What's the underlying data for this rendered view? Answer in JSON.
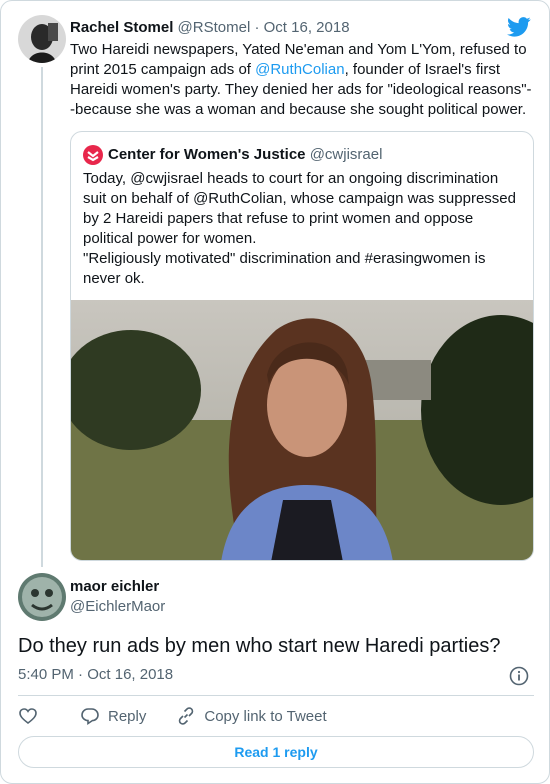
{
  "tweet": {
    "author_name": "Rachel Stomel",
    "author_handle": "@RStomel",
    "date": "Oct 16, 2018",
    "text_before_link": "Two Hareidi newspapers, Yated Ne'eman and Yom L'Yom, refused to print 2015 campaign ads of ",
    "link_text": "@RuthColian",
    "text_after_link": ", founder of Israel's first Hareidi women's party. They denied her ads for \"ideological reasons\"--because she was a woman and because she sought political power."
  },
  "quote": {
    "author_name": "Center for Women's Justice",
    "author_handle": "@cwjisrael",
    "text_lines": [
      "Today, @cwjisrael heads to court for an ongoing discrimination suit on behalf of @RuthColian, whose campaign was suppressed by 2 Hareidi papers that refuse to print women and oppose political power for women.",
      "\"Religiously motivated\" discrimination and #erasingwomen is never ok."
    ]
  },
  "reply": {
    "author_name": "maor eichler",
    "author_handle": "@EichlerMaor",
    "text": "Do they run ads by men who start new Haredi parties?",
    "time": "5:40 PM",
    "date": "Oct 16, 2018"
  },
  "actions": {
    "reply_label": "Reply",
    "copy_link_label": "Copy link to Tweet"
  },
  "read_replies_label": "Read 1 reply",
  "colors": {
    "accent": "#1d9bf0",
    "secondary_text": "#536471",
    "border": "#cfd9de",
    "logo_red": "#e8274b"
  },
  "icons": [
    "twitter-bird-icon",
    "heart-icon",
    "reply-icon",
    "link-icon",
    "info-icon"
  ]
}
